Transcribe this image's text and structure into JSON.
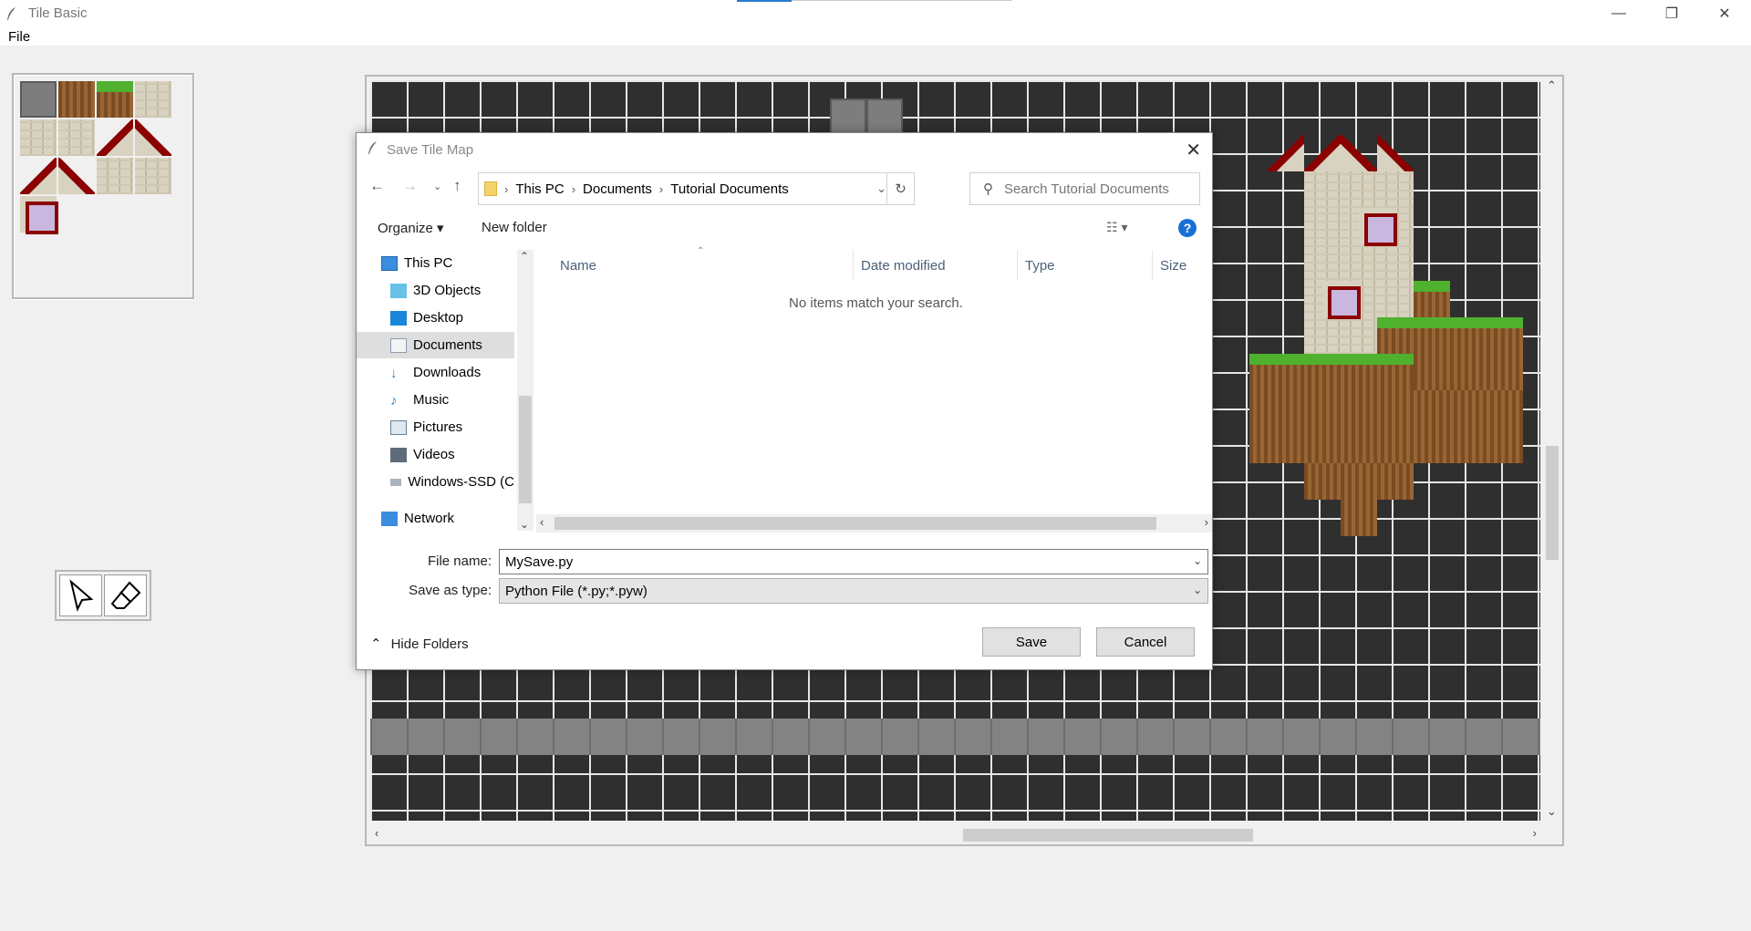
{
  "app": {
    "title": "Tile Basic",
    "menu": [
      "File"
    ],
    "window_controls": [
      "minimize-icon",
      "restore-icon",
      "close-icon"
    ]
  },
  "palette": {
    "tiles": [
      "stone",
      "dirt",
      "grass",
      "brick-roof-corner",
      "brick",
      "brick",
      "roof-left",
      "roof-right",
      "roof-left",
      "roof-right",
      "brick",
      "brick",
      "window"
    ]
  },
  "tools": [
    "select-arrow-icon",
    "eraser-icon"
  ],
  "dialog": {
    "title": "Save Tile Map",
    "breadcrumb": [
      "This PC",
      "Documents",
      "Tutorial Documents"
    ],
    "search_placeholder": "Search Tutorial Documents",
    "toolbar": {
      "organize": "Organize",
      "new_folder": "New folder"
    },
    "nav": [
      {
        "label": "This PC",
        "icon": "computer-icon"
      },
      {
        "label": "3D Objects",
        "icon": "cube-icon"
      },
      {
        "label": "Desktop",
        "icon": "desktop-icon"
      },
      {
        "label": "Documents",
        "icon": "document-icon",
        "selected": true
      },
      {
        "label": "Downloads",
        "icon": "download-icon"
      },
      {
        "label": "Music",
        "icon": "music-icon"
      },
      {
        "label": "Pictures",
        "icon": "pictures-icon"
      },
      {
        "label": "Videos",
        "icon": "videos-icon"
      },
      {
        "label": "Windows-SSD (C",
        "icon": "drive-icon"
      },
      {
        "label": "Network",
        "icon": "network-icon"
      }
    ],
    "columns": [
      "Name",
      "Date modified",
      "Type",
      "Size"
    ],
    "empty_message": "No items match your search.",
    "file_name_label": "File name:",
    "file_name_value": "MySave.py",
    "save_type_label": "Save as type:",
    "save_type_value": "Python File (*.py;*.pyw)",
    "hide_folders": "Hide Folders",
    "save_button": "Save",
    "cancel_button": "Cancel"
  }
}
